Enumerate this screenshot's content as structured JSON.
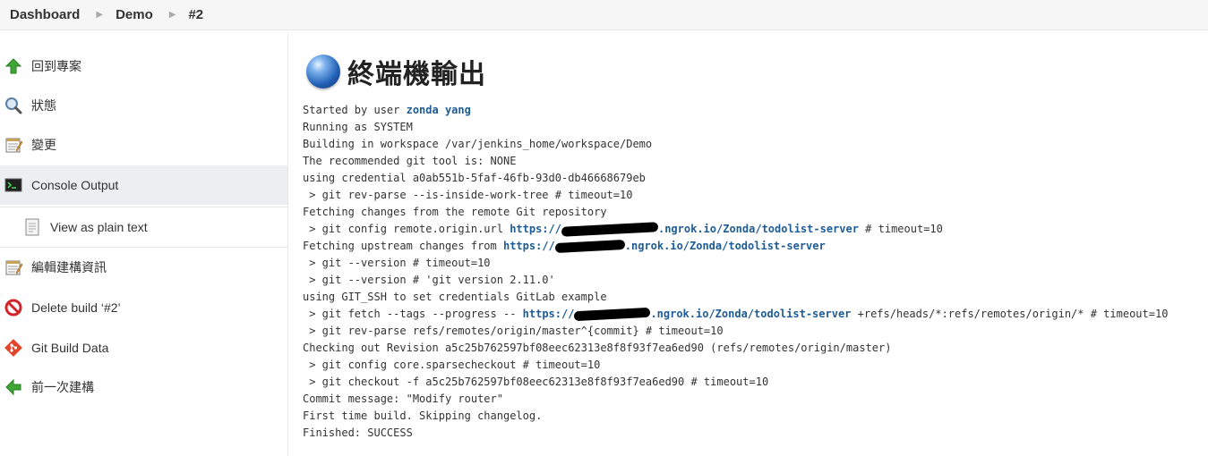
{
  "breadcrumb": [
    "Dashboard",
    "Demo",
    "#2"
  ],
  "sidebar": {
    "items": [
      {
        "label": "回到專案",
        "icon": "up-arrow-icon"
      },
      {
        "label": "狀態",
        "icon": "magnifier-icon"
      },
      {
        "label": "變更",
        "icon": "notepad-icon"
      },
      {
        "label": "Console Output",
        "icon": "terminal-icon"
      },
      {
        "label": "View as plain text",
        "icon": "document-icon"
      },
      {
        "label": "編輯建構資訊",
        "icon": "notepad-icon"
      },
      {
        "label": "Delete build ‘#2’",
        "icon": "no-entry-icon"
      },
      {
        "label": "Git Build Data",
        "icon": "git-icon"
      },
      {
        "label": "前一次建構",
        "icon": "left-arrow-icon"
      }
    ]
  },
  "main": {
    "title": "終端機輸出",
    "console": {
      "l1_prefix": "Started by user ",
      "l1_user": "zonda yang",
      "l2": "Running as SYSTEM",
      "l3": "Building in workspace /var/jenkins_home/workspace/Demo",
      "l4": "The recommended git tool is: NONE",
      "l5": "using credential a0ab551b-5faf-46fb-93d0-db46668679eb",
      "l6": " > git rev-parse --is-inside-work-tree # timeout=10",
      "l7": "Fetching changes from the remote Git repository",
      "l8_prefix": " > git config remote.origin.url ",
      "url_prefix": "https://",
      "url_suffix": ".ngrok.io/Zonda/todolist-server",
      "l8_suffix": " # timeout=10",
      "l9_prefix": "Fetching upstream changes from ",
      "l10": " > git --version # timeout=10",
      "l11": " > git --version # 'git version 2.11.0'",
      "l12": "using GIT_SSH to set credentials GitLab example",
      "l13_prefix": " > git fetch --tags --progress -- ",
      "l13_suffix": " +refs/heads/*:refs/remotes/origin/* # timeout=10",
      "l14": " > git rev-parse refs/remotes/origin/master^{commit} # timeout=10",
      "l15": "Checking out Revision a5c25b762597bf08eec62313e8f8f93f7ea6ed90 (refs/remotes/origin/master)",
      "l16": " > git config core.sparsecheckout # timeout=10",
      "l17": " > git checkout -f a5c25b762597bf08eec62313e8f8f93f7ea6ed90 # timeout=10",
      "l18": "Commit message: \"Modify router\"",
      "l19": "First time build. Skipping changelog.",
      "l20": "Finished: SUCCESS"
    }
  },
  "colors": {
    "link": "#1d5c96",
    "active_bg": "#eceff2"
  }
}
